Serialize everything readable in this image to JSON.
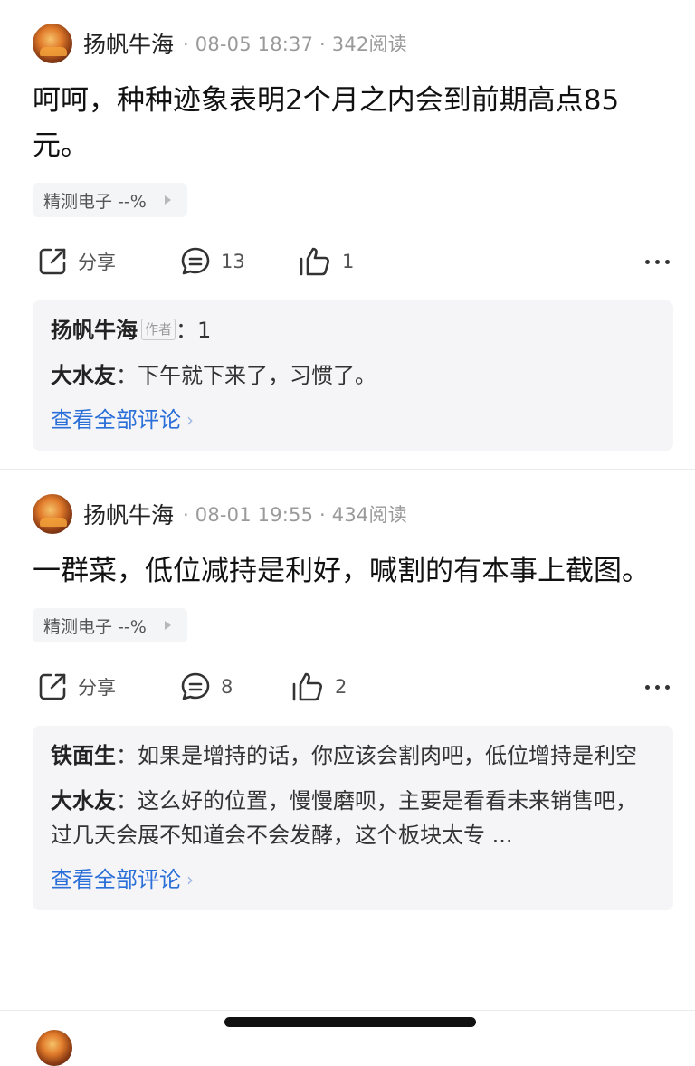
{
  "posts": [
    {
      "author": "扬帆牛海",
      "meta": "· 08-05 18:37 · 342阅读",
      "content": "呵呵，种种迹象表明2个月之内会到前期高点85元。",
      "stock_tag": "精测电子 --%",
      "share_label": "分享",
      "comment_count": "13",
      "like_count": "1",
      "comments": [
        {
          "name": "扬帆牛海",
          "author_badge": "作者",
          "text": "：1"
        },
        {
          "name": "大水友",
          "text": "：下午就下来了，习惯了。"
        }
      ],
      "view_all": "查看全部评论"
    },
    {
      "author": "扬帆牛海",
      "meta": "· 08-01 19:55 · 434阅读",
      "content": "一群菜，低位减持是利好，喊割的有本事上截图。",
      "stock_tag": "精测电子 --%",
      "share_label": "分享",
      "comment_count": "8",
      "like_count": "2",
      "comments": [
        {
          "name": "铁面生",
          "text": "：如果是增持的话，你应该会割肉吧，低位增持是利空"
        },
        {
          "name": "大水友",
          "text": "：这么好的位置，慢慢磨呗，主要是看看未来销售吧，过几天会展不知道会不会发酵，这个板块太专 ..."
        }
      ],
      "view_all": "查看全部评论"
    }
  ],
  "icons": {
    "share": "share-icon",
    "comment": "comment-icon",
    "like": "thumbs-up-icon",
    "more": "more-dots-icon"
  },
  "colors": {
    "link": "#2a6fd8",
    "comment_bg": "#f5f5f7",
    "meta": "#9a9a9a"
  }
}
